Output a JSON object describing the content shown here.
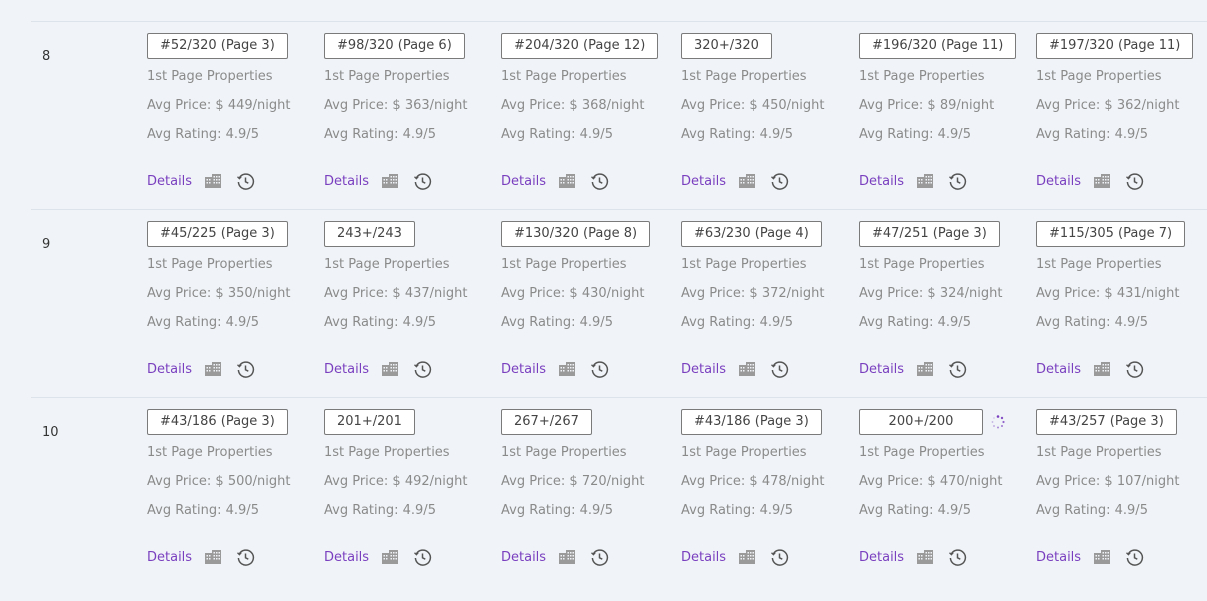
{
  "labels": {
    "first_page": "1st Page Properties",
    "details": "Details"
  },
  "colors": {
    "link": "#7a3fbf",
    "background": "#f0f4f8",
    "badge_border": "#7a7a7a"
  },
  "icons": {
    "building": "building-icon",
    "history": "history-clock-icon",
    "loading": "loading-spinner-icon"
  },
  "rows": [
    {
      "num": "8",
      "cells": [
        {
          "rank": "#52/320 (Page 3)",
          "price": "Avg Price: $ 449/night",
          "rating": "Avg Rating: 4.9/5"
        },
        {
          "rank": "#98/320 (Page 6)",
          "price": "Avg Price: $ 363/night",
          "rating": "Avg Rating: 4.9/5"
        },
        {
          "rank": "#204/320 (Page 12)",
          "price": "Avg Price: $ 368/night",
          "rating": "Avg Rating: 4.9/5"
        },
        {
          "rank": "320+/320",
          "price": "Avg Price: $ 450/night",
          "rating": "Avg Rating: 4.9/5"
        },
        {
          "rank": "#196/320 (Page 11)",
          "price": "Avg Price: $ 89/night",
          "rating": "Avg Rating: 4.9/5"
        },
        {
          "rank": "#197/320 (Page 11)",
          "price": "Avg Price: $ 362/night",
          "rating": "Avg Rating: 4.9/5"
        }
      ]
    },
    {
      "num": "9",
      "cells": [
        {
          "rank": "#45/225 (Page 3)",
          "price": "Avg Price: $ 350/night",
          "rating": "Avg Rating: 4.9/5"
        },
        {
          "rank": "243+/243",
          "price": "Avg Price: $ 437/night",
          "rating": "Avg Rating: 4.9/5"
        },
        {
          "rank": "#130/320 (Page 8)",
          "price": "Avg Price: $ 430/night",
          "rating": "Avg Rating: 4.9/5"
        },
        {
          "rank": "#63/230 (Page 4)",
          "price": "Avg Price: $ 372/night",
          "rating": "Avg Rating: 4.9/5"
        },
        {
          "rank": "#47/251 (Page 3)",
          "price": "Avg Price: $ 324/night",
          "rating": "Avg Rating: 4.9/5"
        },
        {
          "rank": "#115/305 (Page 7)",
          "price": "Avg Price: $ 431/night",
          "rating": "Avg Rating: 4.9/5"
        }
      ]
    },
    {
      "num": "10",
      "cells": [
        {
          "rank": "#43/186 (Page 3)",
          "price": "Avg Price: $ 500/night",
          "rating": "Avg Rating: 4.9/5"
        },
        {
          "rank": "201+/201",
          "price": "Avg Price: $ 492/night",
          "rating": "Avg Rating: 4.9/5"
        },
        {
          "rank": "267+/267",
          "price": "Avg Price: $ 720/night",
          "rating": "Avg Rating: 4.9/5"
        },
        {
          "rank": "#43/186 (Page 3)",
          "price": "Avg Price: $ 478/night",
          "rating": "Avg Rating: 4.9/5"
        },
        {
          "rank": "200+/200",
          "price": "Avg Price: $ 470/night",
          "rating": "Avg Rating: 4.9/5",
          "loading": true
        },
        {
          "rank": "#43/257 (Page 3)",
          "price": "Avg Price: $ 107/night",
          "rating": "Avg Rating: 4.9/5"
        }
      ]
    }
  ]
}
